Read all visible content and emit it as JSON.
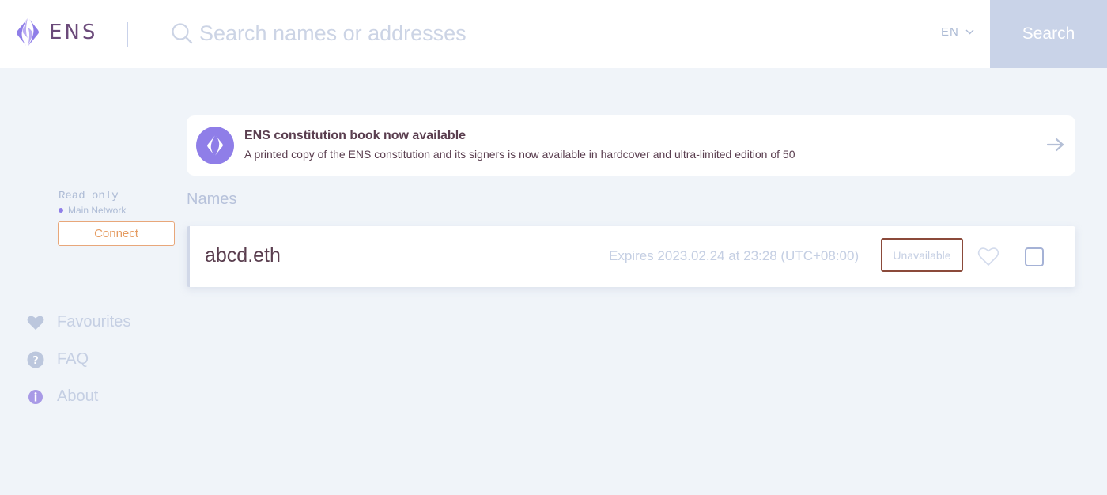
{
  "header": {
    "logo_text": "ENS",
    "search_placeholder": "Search names or addresses",
    "language": "EN",
    "search_button": "Search"
  },
  "sidebar": {
    "mode": "Read only",
    "network": "Main Network",
    "connect_button": "Connect",
    "nav": [
      {
        "label": "Favourites",
        "icon": "heart-icon"
      },
      {
        "label": "FAQ",
        "icon": "question-icon"
      },
      {
        "label": "About",
        "icon": "info-icon"
      }
    ]
  },
  "banner": {
    "title": "ENS constitution book now available",
    "text": "A printed copy of the ENS constitution and its signers is now available in hardcover and ultra-limited edition of 50",
    "icon": "ens-logo-icon",
    "arrow_icon": "arrow-right-icon"
  },
  "names": {
    "section_title": "Names",
    "items": [
      {
        "name": "abcd.eth",
        "expiry": "Expires 2023.02.24 at 23:28 (UTC+08:00)",
        "status": "Unavailable"
      }
    ]
  },
  "colors": {
    "accent": "#8f7ee8",
    "background": "#f0f4f9",
    "search_button": "#c9d3e8",
    "connect_border": "#e8a77a",
    "text_dark": "#5a3e4f"
  }
}
